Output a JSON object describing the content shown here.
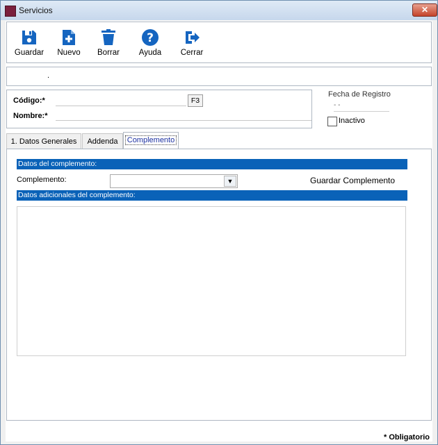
{
  "window": {
    "title": "Servicios",
    "close_label": "✕"
  },
  "toolbar": {
    "buttons": [
      {
        "label": "Guardar",
        "icon": "save-icon"
      },
      {
        "label": "Nuevo",
        "icon": "new-document-icon"
      },
      {
        "label": "Borrar",
        "icon": "trash-icon"
      },
      {
        "label": "Ayuda",
        "icon": "help-icon"
      },
      {
        "label": "Cerrar",
        "icon": "exit-icon"
      }
    ]
  },
  "infobar": {
    "text": "."
  },
  "form": {
    "codigo_label": "Código:*",
    "codigo_value": "",
    "f3_label": "F3",
    "nombre_label": "Nombre:*",
    "nombre_value": "",
    "fecha_label": "Fecha de Registro",
    "fecha_value": "- -",
    "inactivo_label": "Inactivo",
    "inactivo_checked": false
  },
  "tabs": [
    {
      "label": "1. Datos Generales",
      "active": false
    },
    {
      "label": "Addenda",
      "active": false
    },
    {
      "label": "Complemento",
      "active": true
    }
  ],
  "complemento": {
    "header1": "Datos del complemento:",
    "complemento_label": "Complemento:",
    "complemento_value": "",
    "guardar_label": "Guardar Complemento",
    "header2": "Datos adicionales del complemento:"
  },
  "footer": {
    "obligatorio": "* Obligatorio"
  },
  "colors": {
    "accent": "#0a62b8",
    "icon": "#1565c0",
    "title_icon": "#7a1f3d"
  }
}
